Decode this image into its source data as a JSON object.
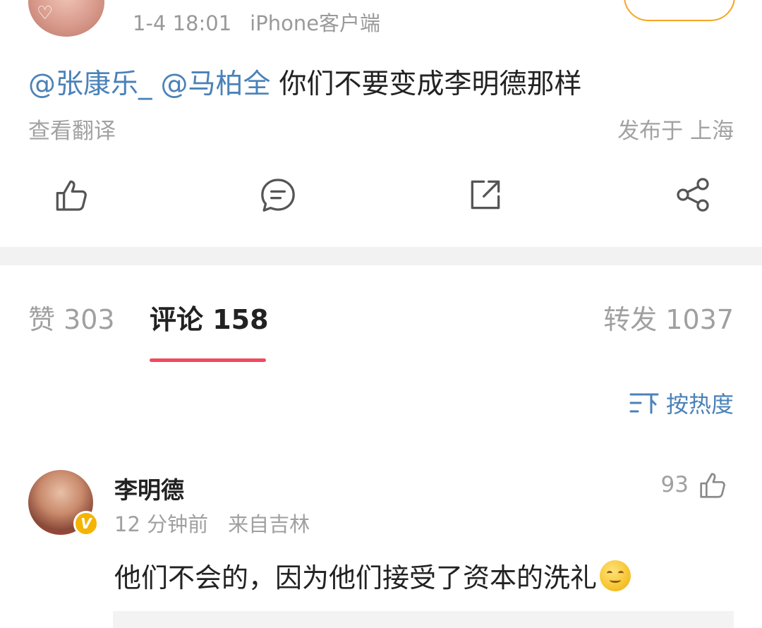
{
  "post": {
    "date": "1-4 18:01",
    "source": "iPhone客户端",
    "mentions": [
      "@张康乐_",
      "@马柏全"
    ],
    "text": "你们不要变成李明德那样",
    "translate": "查看翻译",
    "location": "发布于 上海"
  },
  "actions": [
    {
      "name": "like",
      "icon": "thumbs-up-icon"
    },
    {
      "name": "comment",
      "icon": "comment-bubble-icon"
    },
    {
      "name": "repost",
      "icon": "external-link-icon"
    },
    {
      "name": "share",
      "icon": "share-icon"
    }
  ],
  "tabs": {
    "likes": "赞 303",
    "comments": "评论 158",
    "reposts": "转发 1037"
  },
  "sort": {
    "label": "按热度",
    "icon": "sort-icon"
  },
  "comment": {
    "author": "李明德",
    "verified_badge": "V",
    "time": "12 分钟前",
    "source": "来自吉林",
    "likes": "93",
    "text": "他们不会的，因为他们接受了资本的洗礼",
    "emoji": "smile-emoji"
  },
  "colors": {
    "link": "#4b82b8",
    "accent_underline": "#f04a5c",
    "follow_border": "#f5a623",
    "badge": "#f5b400",
    "muted_text": "#a0a0a0"
  }
}
